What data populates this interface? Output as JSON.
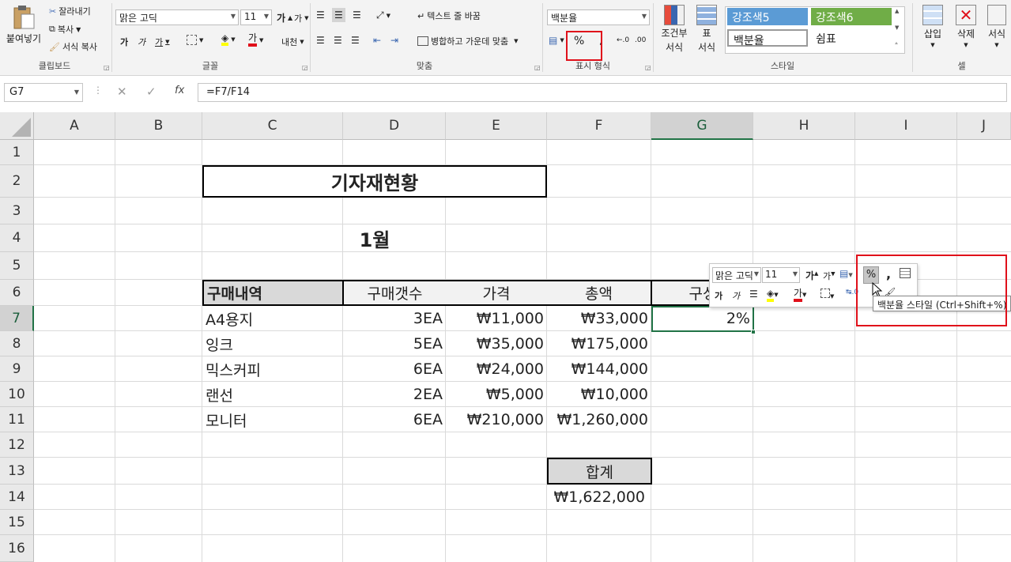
{
  "ribbon": {
    "clipboard": {
      "paste": "붙여넣기",
      "cut": "잘라내기",
      "copy": "복사",
      "format_painter": "서식 복사",
      "label": "클립보드"
    },
    "font": {
      "name": "맑은 고딕",
      "size": "11",
      "increase": "가",
      "decrease": "가",
      "bold": "가",
      "italic": "가",
      "underline": "가",
      "font_color_glyph": "가",
      "phonetic": "내천",
      "label": "글꼴",
      "colors": {
        "highlight": "#ffff00",
        "font_color": "#e0101a"
      }
    },
    "alignment": {
      "wrap_text": "텍스트 줄 바꿈",
      "merge_center": "병합하고 가운데 맞춤",
      "label": "맞춤"
    },
    "number": {
      "format": "백분율",
      "percent": "%",
      "label": "표시 형식"
    },
    "styles": {
      "conditional": [
        "조건부",
        "서식"
      ],
      "format_table": [
        "표",
        "서식"
      ],
      "accent5": "강조색5",
      "accent6": "강조색6",
      "percent_style": "백분율",
      "comma_style": "쉼표",
      "label": "스타일",
      "colors": {
        "accent5": "#5b9bd5",
        "accent6": "#70ad47"
      }
    },
    "cells": {
      "insert": "삽입",
      "delete": "삭제",
      "format": "서식",
      "label": "셀"
    }
  },
  "formula_bar": {
    "name_box": "G7",
    "fx": "fx",
    "formula": "=F7/F14"
  },
  "grid": {
    "columns": [
      "A",
      "B",
      "C",
      "D",
      "E",
      "F",
      "G",
      "H",
      "I",
      "J"
    ],
    "rows": [
      "1",
      "2",
      "3",
      "4",
      "5",
      "6",
      "7",
      "8",
      "9",
      "10",
      "11",
      "12",
      "13",
      "14",
      "15",
      "16"
    ],
    "selected_column": "G",
    "selected_row": "7",
    "title": "기자재현황",
    "month": "1월",
    "headers": [
      "구매내역",
      "구매갯수",
      "가격",
      "총액",
      "구성"
    ],
    "items": [
      {
        "name": "A4용지",
        "qty": "3EA",
        "price": "₩11,000",
        "total": "₩33,000",
        "ratio": "2%"
      },
      {
        "name": "잉크",
        "qty": "5EA",
        "price": "₩35,000",
        "total": "₩175,000",
        "ratio": ""
      },
      {
        "name": "믹스커피",
        "qty": "6EA",
        "price": "₩24,000",
        "total": "₩144,000",
        "ratio": ""
      },
      {
        "name": "랜선",
        "qty": "2EA",
        "price": "₩5,000",
        "total": "₩10,000",
        "ratio": ""
      },
      {
        "name": "모니터",
        "qty": "6EA",
        "price": "₩210,000",
        "total": "₩1,260,000",
        "ratio": ""
      }
    ],
    "sum_label": "합계",
    "sum_value": "₩1,622,000"
  },
  "mini_toolbar": {
    "font": "맑은 고딕",
    "size": "11",
    "percent": "%",
    "comma": ",",
    "tooltip": "백분율 스타일 (Ctrl+Shift+%)"
  }
}
